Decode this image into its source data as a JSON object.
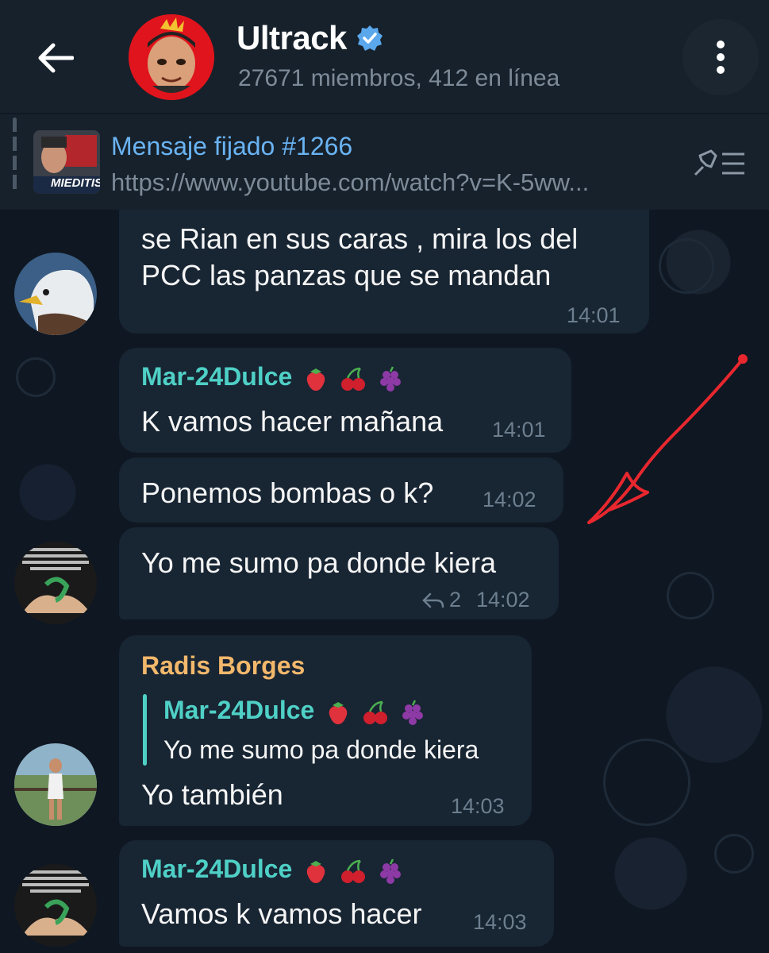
{
  "header": {
    "title": "Ultrack",
    "subtitle": "27671 miembros, 412 en línea"
  },
  "pinned": {
    "title": "Mensaje fijado #1266",
    "url": "https://www.youtube.com/watch?v=K-5ww...",
    "thumb_text": "MIEDITIS"
  },
  "messages": [
    {
      "lines": [
        "se Rian en sus caras , mira los del",
        "PCC las panzas que se mandan"
      ],
      "time": "14:01"
    },
    {
      "sender": "Mar-24Dulce",
      "text": "K vamos hacer mañana",
      "time": "14:01"
    },
    {
      "text": "Ponemos bombas o k?",
      "time": "14:02"
    },
    {
      "text": "Yo me sumo pa donde kiera",
      "reply_count": "2",
      "time": "14:02"
    },
    {
      "sender": "Radis Borges",
      "reply_sender": "Mar-24Dulce",
      "reply_text": "Yo me sumo pa donde kiera",
      "text": "Yo también",
      "time": "14:03"
    },
    {
      "sender": "Mar-24Dulce",
      "text": "Vamos k vamos hacer",
      "time": "14:03"
    }
  ],
  "colors": {
    "header_bg": "#17212b",
    "bubble_bg": "#182533",
    "teal_sender": "#4fd0c6",
    "orange_sender": "#f2b86b",
    "link_blue": "#6ab3f3",
    "annotation_red": "#e8272e"
  },
  "icons": [
    "back-arrow-icon",
    "verified-badge-icon",
    "more-vert-icon",
    "pinned-list-icon",
    "reply-icon",
    "strawberry-icon",
    "cherries-icon",
    "grapes-icon"
  ]
}
